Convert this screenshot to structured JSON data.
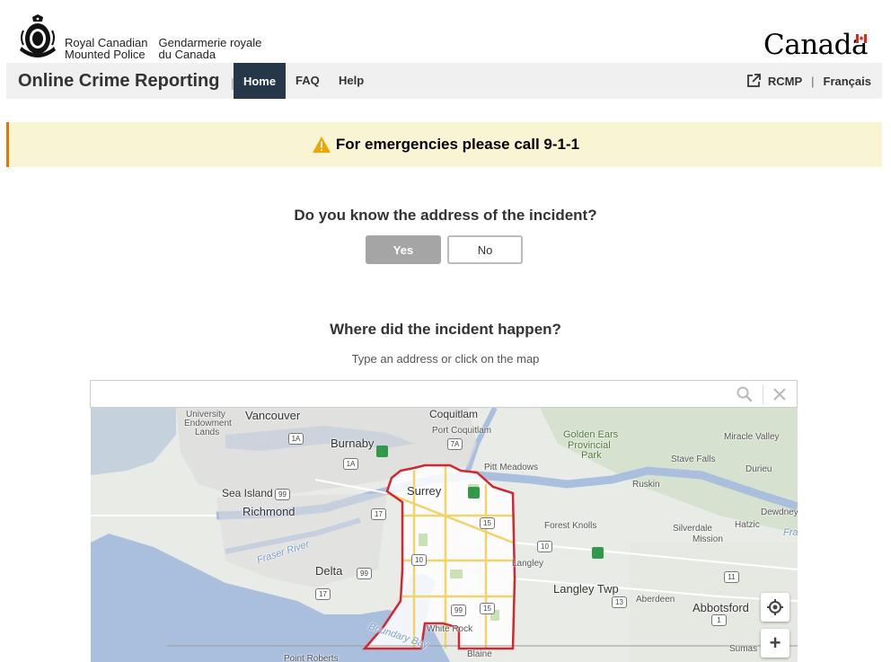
{
  "header": {
    "org_en_line1": "Royal Canadian",
    "org_en_line2": "Mounted Police",
    "org_fr_line1": "Gendarmerie royale",
    "org_fr_line2": "du Canada",
    "wordmark": "Canada"
  },
  "nav": {
    "app_title": "Online Crime Reporting",
    "separator": "|",
    "items": [
      {
        "label": "Home",
        "active": true
      },
      {
        "label": "FAQ",
        "active": false
      },
      {
        "label": "Help",
        "active": false
      }
    ],
    "rcmp_link": "RCMP",
    "pipe": "|",
    "language": "Français"
  },
  "alert": {
    "message": "For emergencies please call 9-1-1",
    "icon": "warning-triangle-icon",
    "color": "#f2a500"
  },
  "address_question": {
    "text": "Do you know the address of the incident?",
    "yes_label": "Yes",
    "no_label": "No",
    "selected": "Yes"
  },
  "location": {
    "heading": "Where did the incident happen?",
    "hint": "Type an address or click on the map",
    "search_value": ""
  },
  "map": {
    "labels": {
      "university": "University",
      "endowment": "Endowment",
      "lands": "Lands",
      "vancouver": "Vancouver",
      "coquitlam": "Coquitlam",
      "port_coquitlam": "Port Coquitlam",
      "golden_ears": "Golden Ears",
      "provincial": "Provincial",
      "park": "Park",
      "miracle_valley": "Miracle Valley",
      "burnaby": "Burnaby",
      "pitt_meadows": "Pitt Meadows",
      "stave_falls": "Stave Falls",
      "durieu": "Durieu",
      "sea_island": "Sea Island",
      "surrey": "Surrey",
      "ruskin": "Ruskin",
      "richmond": "Richmond",
      "dewdney": "Dewdney",
      "forest_knolls": "Forest Knolls",
      "silverdale": "Silverdale",
      "hatzic": "Hatzic",
      "mission": "Mission",
      "fraser_river": "Fraser River",
      "fra": "Fra",
      "delta": "Delta",
      "langley": "Langley",
      "langley_twp": "Langley Twp",
      "aberdeen": "Aberdeen",
      "abbotsford": "Abbotsford",
      "boundary_bay": "Boundary Bay",
      "white_rock": "White Rock",
      "sumas": "Sumas",
      "point_roberts": "Point Roberts",
      "blaine": "Blaine"
    },
    "highways": [
      "1A",
      "7A",
      "1A",
      "99",
      "17",
      "15",
      "10",
      "10",
      "99",
      "17",
      "99",
      "15",
      "13",
      "11",
      "1"
    ],
    "zoom_in_label": "+"
  }
}
